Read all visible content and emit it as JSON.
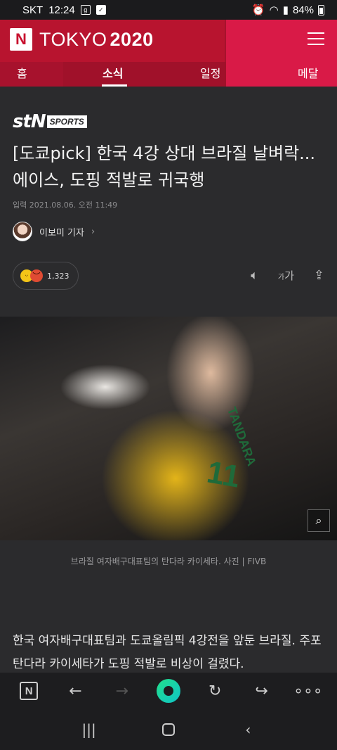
{
  "status_bar": {
    "carrier": "SKT",
    "time": "12:24",
    "icon_g": "g",
    "icon_check": "✓",
    "battery": "84%"
  },
  "header": {
    "logo": "N",
    "brand_light": "TOKYO",
    "brand_bold": "2020",
    "tabs": [
      {
        "label": "홈"
      },
      {
        "label": "소식"
      },
      {
        "label": "일정"
      },
      {
        "label": "메달"
      }
    ],
    "colors": {
      "primary": "#b8142f",
      "accent": "#d91a47"
    }
  },
  "article": {
    "source_logo": "stN",
    "source_logo_suffix": "SPORTS",
    "headline": "[도쿄pick] 한국 4강 상대 브라질 날벼락...에이스, 도핑 적발로 귀국행",
    "published": "입력 2021.08.06. 오전 11:49",
    "author": "이보미 기자",
    "author_chevron": "›",
    "reaction_count": "1,323",
    "tools": {
      "font_small": "가",
      "font_large": "가"
    },
    "photo": {
      "jersey_text": "TANDARA",
      "jersey_number": "11"
    },
    "caption": "브라질 여자배구대표팀의 탄다라 카이세타. 사진 | FIVB",
    "body": "한국 여자배구대표팀과 도쿄올림픽 4강전을 앞둔 브라질. 주포 탄다라 카이세타가 도핑 적발로 비상이 걸렸다."
  },
  "browser_bar": {
    "items": [
      "n-icon",
      "back-icon",
      "forward-icon",
      "home-dot-icon",
      "reload-icon",
      "share-icon",
      "more-icon"
    ]
  },
  "nav_bar": {
    "items": [
      "recents-icon",
      "home-icon",
      "back-icon"
    ]
  }
}
